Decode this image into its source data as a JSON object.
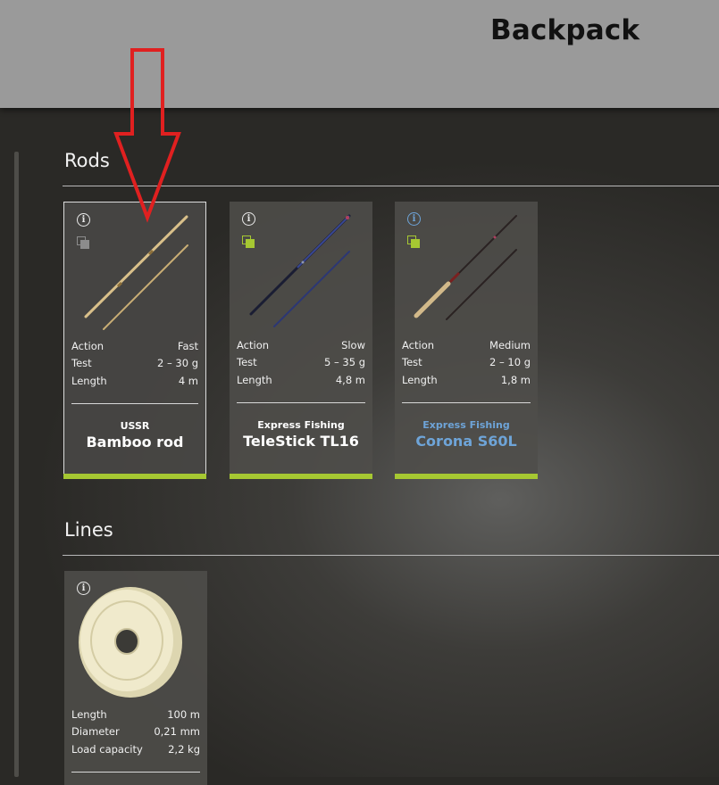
{
  "header": {
    "title": "Backpack"
  },
  "sections": {
    "rods": {
      "heading": "Rods",
      "items": [
        {
          "brand": "USSR",
          "model": "Bamboo rod",
          "specs": [
            {
              "label": "Action",
              "value": "Fast"
            },
            {
              "label": "Test",
              "value": "2 – 30 g"
            },
            {
              "label": "Length",
              "value": "4 m"
            }
          ]
        },
        {
          "brand": "Express Fishing",
          "model": "TeleStick TL16",
          "specs": [
            {
              "label": "Action",
              "value": "Slow"
            },
            {
              "label": "Test",
              "value": "5 – 35 g"
            },
            {
              "label": "Length",
              "value": "4,8 m"
            }
          ]
        },
        {
          "brand": "Express Fishing",
          "model": "Corona S60L",
          "specs": [
            {
              "label": "Action",
              "value": "Medium"
            },
            {
              "label": "Test",
              "value": "2 – 10 g"
            },
            {
              "label": "Length",
              "value": "1,8 m"
            }
          ]
        }
      ]
    },
    "lines": {
      "heading": "Lines",
      "items": [
        {
          "specs": [
            {
              "label": "Length",
              "value": "100 m"
            },
            {
              "label": "Diameter",
              "value": "0,21 mm"
            },
            {
              "label": "Load capacity",
              "value": "2,2 kg"
            }
          ]
        }
      ]
    }
  },
  "colors": {
    "accent_green": "#a6c832",
    "highlight_blue": "#6ea4d8",
    "annotation_red": "#e02020",
    "header_bg": "#9a9a9a"
  },
  "icons": [
    "info-icon",
    "copy-icon",
    "annotation-arrow"
  ]
}
